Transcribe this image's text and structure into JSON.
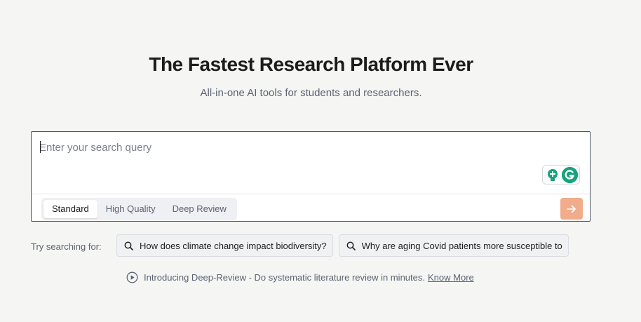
{
  "hero": {
    "title": "The Fastest Research Platform Ever",
    "subtitle": "All-in-one AI tools for students and researchers."
  },
  "search": {
    "placeholder": "Enter your search query",
    "value": "",
    "modes": [
      {
        "label": "Standard",
        "selected": true
      },
      {
        "label": "High Quality",
        "selected": false
      },
      {
        "label": "Deep Review",
        "selected": false
      }
    ],
    "submit_icon": "arrow-right-icon",
    "extension_icons": [
      "lightbulb-plus-icon",
      "grammarly-icon"
    ]
  },
  "suggestions": {
    "label": "Try searching for:",
    "items": [
      "How does climate change impact biodiversity?",
      "Why are aging Covid patients more susceptible to"
    ],
    "icon": "search-icon"
  },
  "announcement": {
    "text": "Introducing Deep-Review - Do systematic literature review in minutes.",
    "link_label": "Know More",
    "icon": "play-circle-icon"
  },
  "colors": {
    "background": "#f5f5f3",
    "submit_button": "#f1ac8b",
    "grammarly_green": "#15a37c",
    "muted_text": "#5b6473"
  }
}
